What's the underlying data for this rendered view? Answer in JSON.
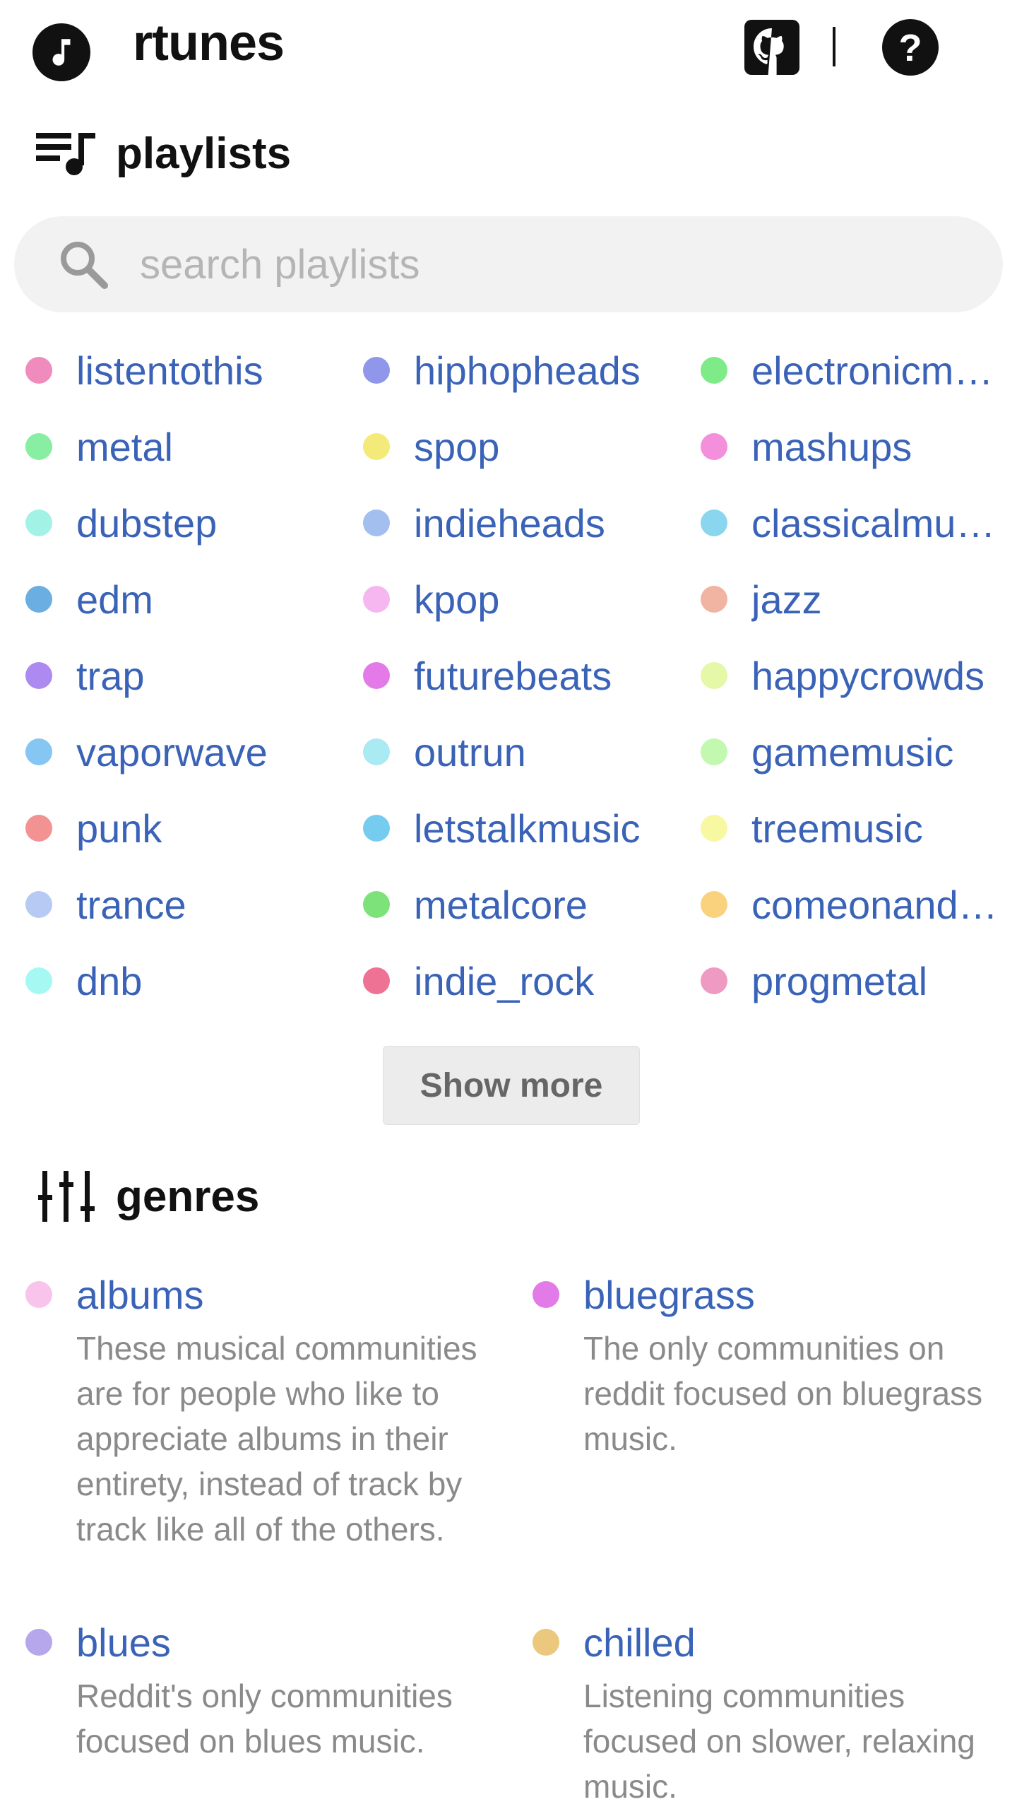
{
  "header": {
    "title": "rtunes",
    "icons": [
      "music-note-icon",
      "github-icon",
      "help-icon"
    ]
  },
  "playlists_section": {
    "heading": "playlists",
    "icon": "playlist-icon",
    "search_placeholder": "search playlists",
    "items": [
      {
        "label": "listentothis",
        "color": "#f08bbd"
      },
      {
        "label": "hiphopheads",
        "color": "#9097ea"
      },
      {
        "label": "electronicm…",
        "color": "#7eea88"
      },
      {
        "label": "metal",
        "color": "#88eea2"
      },
      {
        "label": "spop",
        "color": "#f4ea7a"
      },
      {
        "label": "mashups",
        "color": "#f48fdc"
      },
      {
        "label": "dubstep",
        "color": "#a2f2e6"
      },
      {
        "label": "indieheads",
        "color": "#a2bff0"
      },
      {
        "label": "classicalmu…",
        "color": "#8ad6ee"
      },
      {
        "label": "edm",
        "color": "#6aaee2"
      },
      {
        "label": "kpop",
        "color": "#f6b6f0"
      },
      {
        "label": "jazz",
        "color": "#f2b4a2"
      },
      {
        "label": "trap",
        "color": "#ac8af0"
      },
      {
        "label": "futurebeats",
        "color": "#e47ae8"
      },
      {
        "label": "happycrowds",
        "color": "#e4f8a8"
      },
      {
        "label": "vaporwave",
        "color": "#86c6f2"
      },
      {
        "label": "outrun",
        "color": "#aaeaf2"
      },
      {
        "label": "gamemusic",
        "color": "#c2f8b0"
      },
      {
        "label": "punk",
        "color": "#f29292"
      },
      {
        "label": "letstalkmusic",
        "color": "#76ccee"
      },
      {
        "label": "treemusic",
        "color": "#f8f8a2"
      },
      {
        "label": "trance",
        "color": "#b6caf4"
      },
      {
        "label": "metalcore",
        "color": "#7ee27a"
      },
      {
        "label": "comeonand…",
        "color": "#fad27e"
      },
      {
        "label": "dnb",
        "color": "#a6f8f2"
      },
      {
        "label": "indie_rock",
        "color": "#ee7294"
      },
      {
        "label": "progmetal",
        "color": "#ee9ac2"
      }
    ],
    "show_more_label": "Show more"
  },
  "genres_section": {
    "heading": "genres",
    "icon": "sliders-icon",
    "items": [
      {
        "label": "albums",
        "color": "#f8c4ec",
        "description": "These musical communities are for people who like to appreciate albums in their entirety, instead of track by track like all of the others."
      },
      {
        "label": "bluegrass",
        "color": "#e27ae8",
        "description": "The only communities on reddit focused on bluegrass music."
      },
      {
        "label": "blues",
        "color": "#b6a6ec",
        "description": "Reddit's only communities focused on blues music."
      },
      {
        "label": "chilled",
        "color": "#ecc87e",
        "description": "Listening communities focused on slower, relaxing music."
      }
    ]
  }
}
